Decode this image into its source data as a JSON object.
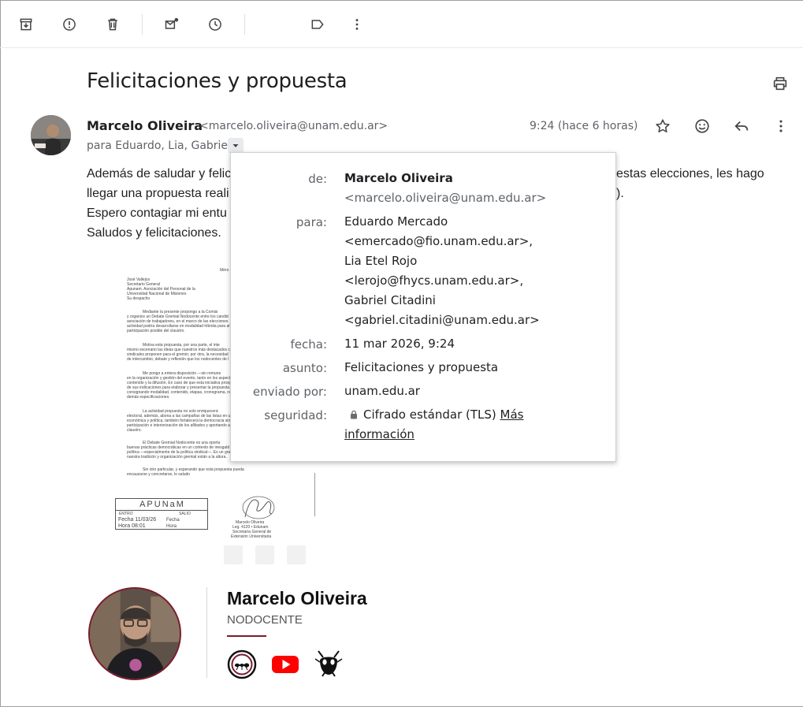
{
  "toolbar": {
    "items": [
      "archive-icon",
      "report-spam-icon",
      "delete-icon",
      "mark-unread-icon",
      "snooze-icon",
      "label-icon",
      "more-vert-icon"
    ]
  },
  "message": {
    "subject": "Felicitaciones y propuesta",
    "sender_name": "Marcelo Oliveira",
    "sender_email": "<marcelo.oliveira@unam.edu.ar>",
    "to_line": "para Eduardo, Lia, Gabriel",
    "time": "9:24 (hace 6 horas)",
    "body": [
      "Además de saludar y felic",
      "llegar una propuesta reali",
      "Espero contagiar mi entu",
      "Saludos y felicitaciones."
    ],
    "body_right": [
      "estas elecciones, les hago",
      ")."
    ]
  },
  "details": {
    "de_label": "de:",
    "de_name": "Marcelo Oliveira",
    "de_email": "<marcelo.oliveira@unam.edu.ar>",
    "para_label": "para:",
    "para_lines": [
      "Eduardo Mercado",
      "<emercado@fio.unam.edu.ar>,",
      "Lia Etel Rojo",
      "<lerojo@fhycs.unam.edu.ar>,",
      "Gabriel Citadini",
      "<gabriel.citadini@unam.edu.ar>"
    ],
    "fecha_label": "fecha:",
    "fecha": "11 mar 2026, 9:24",
    "asunto_label": "asunto:",
    "asunto": "Felicitaciones y propuesta",
    "enviado_label": "enviado por:",
    "enviado": "unam.edu.ar",
    "seguridad_label": "seguridad:",
    "seguridad": "Cifrado estándar (TLS)",
    "mas_info_1": "Más",
    "mas_info_2": "información"
  },
  "attachment": {
    "header_right": "Méro",
    "lines": [
      "José Vallejos",
      "Secretario General",
      "Apunam. Asociación del Personal de la",
      "Universidad Nacional de Misiones",
      "Su despacho"
    ],
    "para1": [
      "Mediante la presente propongo a la Comisi",
      "y organice un Debate Gremial Nodocente entre los candid",
      "asociación de trabajadores, en el marco de las elecciones",
      "actividad podría desarrollarse en modalidad híbrida para al",
      "participación posible del claustro."
    ],
    "para2": [
      "Motiva esta propuesta, por una parte, el inte",
      "mismo escenario las ideas que nuestros más destacados c",
      "sindicales proponen para el gremio; por otra, la necesidad",
      "de intercambio, debate y reflexión que los nodocentes de l"
    ],
    "para3": [
      "Me pongo a entera disposición —sin remune",
      "en la organización y gestión del evento, tanto en los aspect",
      "contenido y la difusión. En caso de que esta iniciativa prosp",
      "de sus indicaciones para elaborar y presentar la propuesta",
      "consignando modalidad, contenido, etapas, cronograma, re",
      "demás especificaciones."
    ],
    "para4": [
      "La actividad propuesta no solo enriquecerá",
      "electoral, además, abona a las campañas de las listas en u",
      "económica y política, también fortalecerá la democracia sin",
      "participación e interiorización de los afiliados y aportando a",
      "claustro."
    ],
    "para5": [
      "El Debate Gremial Nodocente es una oportu",
      "buenas prácticas democráticas en un contexto de inesgabl",
      "política —especialmente de la política sindical—. Es un gra",
      "nuestra tradición y organización gremial están a la altura."
    ],
    "closing": [
      "Sin otro particular, y esperando que esta propuesta pueda",
      "encauzarse y concretarse, lo saludo"
    ],
    "stamp_title": "APUNaM",
    "stamp_lines": [
      "ENTRO",
      "SALIO",
      "Fecha 11/03/26",
      "Fecha",
      "Hora 08:01",
      "Hora"
    ],
    "sign_lines": [
      "Marcelo Oliveira",
      "Leg. 4120 • Edunam",
      "Secretaría General de",
      "Extensión Universitaria"
    ]
  },
  "signature": {
    "name": "Marcelo Oliveira",
    "role": "NODOCENTE",
    "icons": [
      "ant-logo-icon",
      "youtube-icon",
      "ant-head-icon"
    ]
  },
  "colors": {
    "accent": "#7b1c2e",
    "youtube": "#ff0000"
  }
}
